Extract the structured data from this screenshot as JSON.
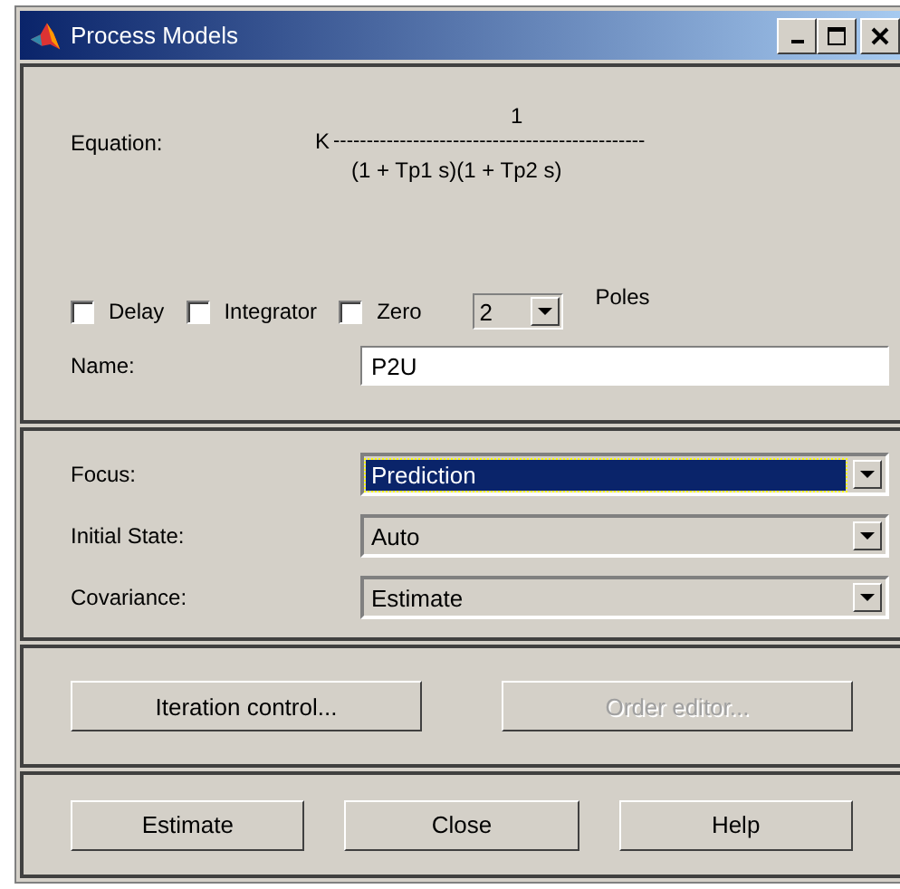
{
  "window": {
    "title": "Process Models"
  },
  "equation": {
    "label": "Equation:",
    "numerator": "1",
    "gain": "K",
    "fraction_line": "-----------------------------------------------",
    "denominator": "(1 + Tp1 s)(1 + Tp2 s)"
  },
  "options": [
    {
      "label": "Delay",
      "checked": false
    },
    {
      "label": "Integrator",
      "checked": false
    },
    {
      "label": "Zero",
      "checked": false
    }
  ],
  "poles": {
    "value": "2",
    "label": "Poles"
  },
  "name": {
    "label": "Name:",
    "value": "P2U"
  },
  "settings": [
    {
      "label": "Focus:",
      "value": "Prediction",
      "focused": true
    },
    {
      "label": "Initial State:",
      "value": "Auto",
      "focused": false
    },
    {
      "label": "Covariance:",
      "value": "Estimate",
      "focused": false
    }
  ],
  "tools": [
    {
      "label": "Iteration control...",
      "disabled": false
    },
    {
      "label": "Order editor...",
      "disabled": true
    }
  ],
  "buttons": [
    "Estimate",
    "Close",
    "Help"
  ]
}
